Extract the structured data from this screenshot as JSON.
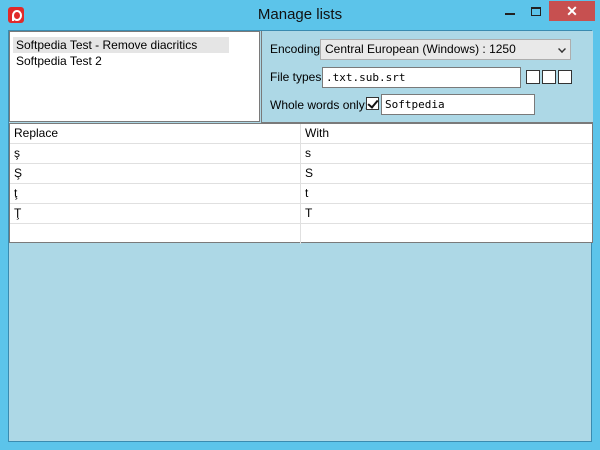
{
  "window": {
    "title": "Manage lists",
    "close_label": "✕"
  },
  "lists": {
    "items": [
      {
        "label": "Softpedia Test - Remove diacritics"
      },
      {
        "label": "Softpedia Test 2"
      }
    ]
  },
  "settings": {
    "encoding_label": "Encoding:",
    "encoding_value": "Central European (Windows) : 1250",
    "file_types_label": "File types:",
    "file_types_value": ".txt.sub.srt",
    "whole_words_label": "Whole words only:",
    "whole_words_checked": true,
    "whole_words_value": "Softpedia"
  },
  "grid": {
    "headers": {
      "replace": "Replace",
      "with": "With"
    },
    "rows": [
      {
        "replace": "ş",
        "with": "s"
      },
      {
        "replace": "Ş",
        "with": "S"
      },
      {
        "replace": "ţ",
        "with": "t"
      },
      {
        "replace": "Ţ",
        "with": "T"
      },
      {
        "replace": "",
        "with": ""
      }
    ]
  },
  "colors": {
    "frame": "#5cc4ea",
    "client_bg": "#add8e6",
    "close_button": "#c75050"
  },
  "icons": {
    "app": "app-logo-icon",
    "minimize": "minimize-icon",
    "maximize": "maximize-icon",
    "close": "close-icon",
    "dropdown": "chevron-down-icon",
    "check": "check-icon"
  }
}
